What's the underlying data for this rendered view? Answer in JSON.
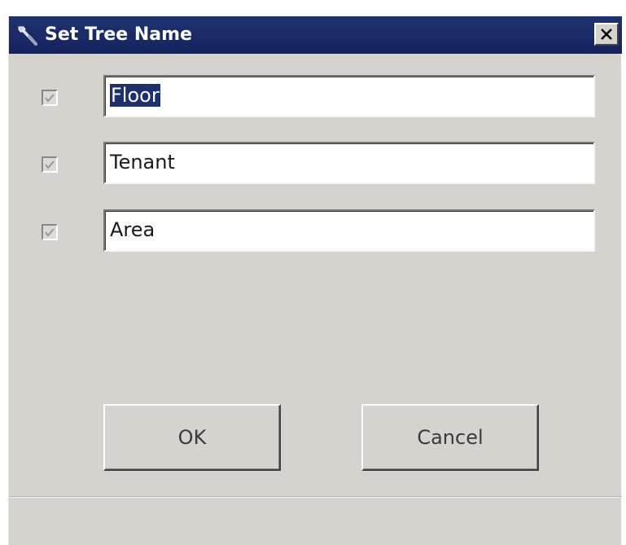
{
  "window": {
    "title": "Set Tree Name",
    "icon": "wrench-icon",
    "close_label": "close"
  },
  "rows": [
    {
      "checked": true,
      "value": "Floor",
      "selected": true
    },
    {
      "checked": true,
      "value": "Tenant",
      "selected": false
    },
    {
      "checked": true,
      "value": "Area",
      "selected": false
    }
  ],
  "buttons": {
    "ok_label": "OK",
    "cancel_label": "Cancel"
  },
  "colors": {
    "titlebar": "#14235e",
    "dialog_bg": "#d6d3ce",
    "selection": "#1c3070"
  }
}
